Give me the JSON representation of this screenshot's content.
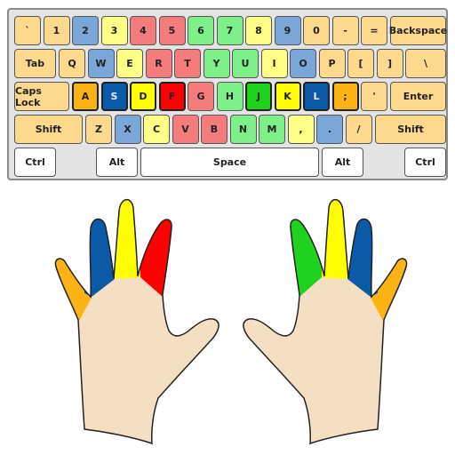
{
  "palette": {
    "lo": "#fcd98c",
    "lb": "#7ba7d8",
    "ly": "#ffff88",
    "lr": "#f47c7c",
    "lg": "#7ef08a",
    "o": "#fbb414",
    "b": "#0b5aa8",
    "y": "#ffff00",
    "r": "#ff0000",
    "g": "#1ed21e",
    "w": "#ffffff",
    "skin": "#f5dfc2"
  },
  "keyboard": {
    "rows": [
      [
        {
          "label": "`",
          "c": "lo"
        },
        {
          "label": "1",
          "c": "lo"
        },
        {
          "label": "2",
          "c": "lb"
        },
        {
          "label": "3",
          "c": "ly"
        },
        {
          "label": "4",
          "c": "lr"
        },
        {
          "label": "5",
          "c": "lr"
        },
        {
          "label": "6",
          "c": "lg"
        },
        {
          "label": "7",
          "c": "lg"
        },
        {
          "label": "8",
          "c": "ly"
        },
        {
          "label": "9",
          "c": "lb"
        },
        {
          "label": "0",
          "c": "lo"
        },
        {
          "label": "-",
          "c": "lo"
        },
        {
          "label": "=",
          "c": "lo"
        },
        {
          "label": "Backspace",
          "c": "lo"
        }
      ],
      [
        {
          "label": "Tab",
          "c": "lo"
        },
        {
          "label": "Q",
          "c": "lo"
        },
        {
          "label": "W",
          "c": "lb"
        },
        {
          "label": "E",
          "c": "ly"
        },
        {
          "label": "R",
          "c": "lr"
        },
        {
          "label": "T",
          "c": "lr"
        },
        {
          "label": "Y",
          "c": "lg"
        },
        {
          "label": "U",
          "c": "lg"
        },
        {
          "label": "I",
          "c": "ly"
        },
        {
          "label": "O",
          "c": "lb"
        },
        {
          "label": "P",
          "c": "lo"
        },
        {
          "label": "[",
          "c": "lo"
        },
        {
          "label": "]",
          "c": "lo"
        },
        {
          "label": "\\",
          "c": "lo"
        }
      ],
      [
        {
          "label": "Caps Lock",
          "c": "lo"
        },
        {
          "label": "A",
          "c": "o",
          "home": true
        },
        {
          "label": "S",
          "c": "b",
          "home": true
        },
        {
          "label": "D",
          "c": "y",
          "home": true
        },
        {
          "label": "F",
          "c": "r",
          "home": true
        },
        {
          "label": "G",
          "c": "lr"
        },
        {
          "label": "H",
          "c": "lg"
        },
        {
          "label": "J",
          "c": "g",
          "home": true
        },
        {
          "label": "K",
          "c": "y",
          "home": true
        },
        {
          "label": "L",
          "c": "b",
          "home": true
        },
        {
          "label": ";",
          "c": "o",
          "home": true
        },
        {
          "label": "'",
          "c": "lo"
        },
        {
          "label": "Enter",
          "c": "lo"
        }
      ],
      [
        {
          "label": "Shift",
          "c": "lo"
        },
        {
          "label": "Z",
          "c": "lo"
        },
        {
          "label": "X",
          "c": "lb"
        },
        {
          "label": "C",
          "c": "ly"
        },
        {
          "label": "V",
          "c": "lr"
        },
        {
          "label": "B",
          "c": "lr"
        },
        {
          "label": "N",
          "c": "lg"
        },
        {
          "label": "M",
          "c": "lg"
        },
        {
          "label": ",",
          "c": "ly"
        },
        {
          "label": ".",
          "c": "lb"
        },
        {
          "label": "/",
          "c": "lo"
        },
        {
          "label": "Shift",
          "c": "lo"
        }
      ],
      [
        {
          "label": "Ctrl",
          "c": "w"
        },
        {
          "label": "Alt",
          "c": "w"
        },
        {
          "label": "Space",
          "c": "w"
        },
        {
          "label": "Alt",
          "c": "w"
        },
        {
          "label": "Ctrl",
          "c": "w"
        }
      ]
    ]
  },
  "hands": {
    "left": {
      "pinky": "o",
      "ring": "b",
      "middle": "y",
      "index": "r"
    },
    "right": {
      "pinky": "o",
      "ring": "b",
      "middle": "y",
      "index": "g"
    }
  }
}
